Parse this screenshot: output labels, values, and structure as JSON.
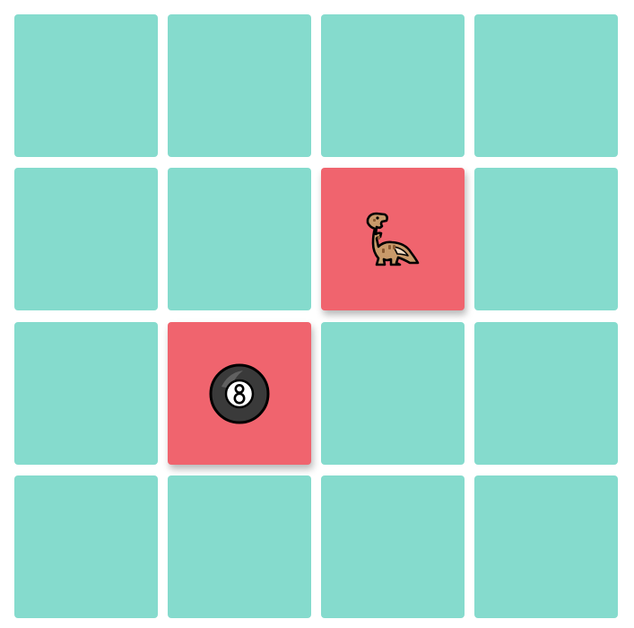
{
  "game": {
    "title": "",
    "colors": {
      "hidden_card": "#85dbcd",
      "revealed_card": "#f0646e",
      "background": "#ffffff"
    },
    "grid": {
      "rows": 4,
      "cols": 4
    },
    "cards": [
      {
        "row": 0,
        "col": 0,
        "state": "hidden",
        "icon": ""
      },
      {
        "row": 0,
        "col": 1,
        "state": "hidden",
        "icon": ""
      },
      {
        "row": 0,
        "col": 2,
        "state": "hidden",
        "icon": ""
      },
      {
        "row": 0,
        "col": 3,
        "state": "hidden",
        "icon": ""
      },
      {
        "row": 1,
        "col": 0,
        "state": "hidden",
        "icon": ""
      },
      {
        "row": 1,
        "col": 1,
        "state": "hidden",
        "icon": ""
      },
      {
        "row": 1,
        "col": 2,
        "state": "revealed",
        "icon": "t-rex-icon"
      },
      {
        "row": 1,
        "col": 3,
        "state": "hidden",
        "icon": ""
      },
      {
        "row": 2,
        "col": 0,
        "state": "hidden",
        "icon": ""
      },
      {
        "row": 2,
        "col": 1,
        "state": "revealed",
        "icon": "eight-ball-icon"
      },
      {
        "row": 2,
        "col": 2,
        "state": "hidden",
        "icon": ""
      },
      {
        "row": 2,
        "col": 3,
        "state": "hidden",
        "icon": ""
      },
      {
        "row": 3,
        "col": 0,
        "state": "hidden",
        "icon": ""
      },
      {
        "row": 3,
        "col": 1,
        "state": "hidden",
        "icon": ""
      },
      {
        "row": 3,
        "col": 2,
        "state": "hidden",
        "icon": ""
      },
      {
        "row": 3,
        "col": 3,
        "state": "hidden",
        "icon": ""
      }
    ]
  }
}
